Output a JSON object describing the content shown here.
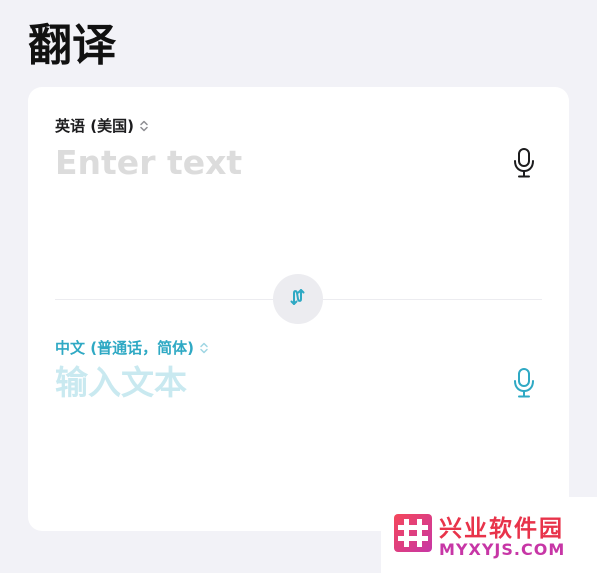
{
  "header": {
    "title": "翻译"
  },
  "source": {
    "language": "英语 (美国)",
    "placeholder": "Enter text",
    "value": ""
  },
  "target": {
    "language": "中文 (普通话，简体)",
    "placeholder": "输入文本",
    "value": ""
  },
  "icons": {
    "source_chevron": "chevron-up-down-icon",
    "target_chevron": "chevron-up-down-icon",
    "source_mic": "microphone-icon",
    "target_mic": "microphone-icon",
    "swap": "swap-arrows-icon"
  },
  "colors": {
    "background": "#f2f2f7",
    "card": "#ffffff",
    "title_text": "#111111",
    "accent": "#2fa9c4",
    "source_placeholder": "#dcdcdc",
    "target_placeholder": "#c9e9f0",
    "swap_button_bg": "#ececf0"
  },
  "watermark": {
    "name": "兴业软件园",
    "domain": "MYXYJS.COM"
  }
}
